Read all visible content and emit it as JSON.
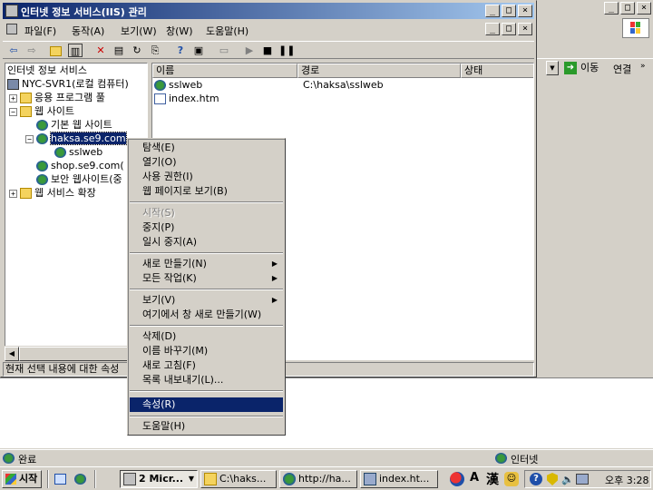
{
  "ie": {
    "addr_go": "이동",
    "links": "연결",
    "status_left": "완료",
    "status_zone": "인터넷"
  },
  "iis": {
    "title": "인터넷 정보 서비스(IIS) 관리",
    "menu": [
      "파일(F)",
      "동작(A)",
      "보기(W)",
      "창(W)",
      "도움말(H)"
    ],
    "tree_root": "인터넷 정보 서비스",
    "tree": [
      {
        "label": "NYC-SVR1(로컬 컴퓨터)",
        "icon": "computer-icon"
      },
      {
        "label": "응용 프로그램 풀",
        "icon": "folder-icon"
      },
      {
        "label": "웹 사이트",
        "icon": "folder-icon"
      },
      {
        "label": "기본 웹 사이트",
        "icon": "globe-icon"
      },
      {
        "label": "haksa.se9.com",
        "icon": "globe-icon"
      },
      {
        "label": "sslweb",
        "icon": "globe-icon"
      },
      {
        "label": "shop.se9.com(",
        "icon": "globe-icon"
      },
      {
        "label": "보안 웹사이트(중",
        "icon": "globe-icon"
      },
      {
        "label": "웹 서비스 확장",
        "icon": "folder-icon"
      }
    ],
    "columns": [
      "이름",
      "경로",
      "상태"
    ],
    "rows": [
      {
        "name": "sslweb",
        "path": "C:\\haksa\\sslweb",
        "icon": "globe-icon"
      },
      {
        "name": "index.htm",
        "path": "",
        "icon": "document-icon"
      }
    ],
    "status": "현재 선택 내용에 대한 속성"
  },
  "context_menu": {
    "items": [
      {
        "label": "탐색(E)"
      },
      {
        "label": "열기(O)"
      },
      {
        "label": "사용 권한(I)"
      },
      {
        "label": "웹 페이지로 보기(B)"
      },
      {
        "label": "시작(S)"
      },
      {
        "label": "중지(P)"
      },
      {
        "label": "일시 중지(A)"
      },
      {
        "label": "새로 만들기(N)"
      },
      {
        "label": "모든 작업(K)"
      },
      {
        "label": "보기(V)"
      },
      {
        "label": "여기에서 창 새로 만들기(W)"
      },
      {
        "label": "삭제(D)"
      },
      {
        "label": "이름 바꾸기(M)"
      },
      {
        "label": "새로 고침(F)"
      },
      {
        "label": "목록 내보내기(L)..."
      },
      {
        "label": "속성(R)"
      },
      {
        "label": "도움말(H)"
      }
    ]
  },
  "taskbar": {
    "start": "시작",
    "tasks": [
      "2 Micr...",
      "C:\\haks...",
      "http://ha...",
      "index.ht..."
    ],
    "clock": "오후 3:28",
    "ime_a": "A",
    "ime_han": "漢"
  }
}
